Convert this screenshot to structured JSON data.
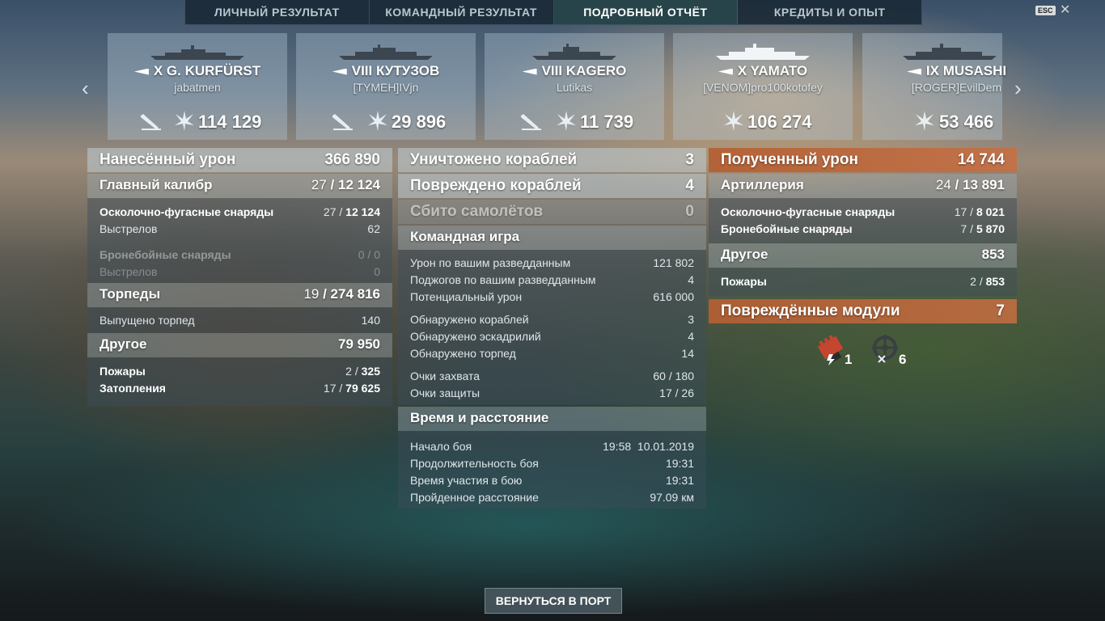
{
  "tabs": [
    "ЛИЧНЫЙ РЕЗУЛЬТАТ",
    "КОМАНДНЫЙ РЕЗУЛЬТАТ",
    "ПОДРОБНЫЙ ОТЧЁТ",
    "КРЕДИТЫ И ОПЫТ"
  ],
  "active_tab": "ПОДРОБНЫЙ ОТЧЁТ",
  "esc_label": "ESC",
  "close_glyph": "✕",
  "nav": {
    "prev": "‹",
    "next": "›"
  },
  "cards": [
    {
      "ship": "X G. KURFÜRST",
      "player": "jabatmen",
      "value": "114 129",
      "torpedo_icon": true
    },
    {
      "ship": "VIII КУТУЗОВ",
      "player": "[TYMEH]IVjn",
      "value": "29 896",
      "torpedo_icon": true
    },
    {
      "ship": "VIII KAGERO",
      "player": "Lutikas",
      "value": "11 739",
      "torpedo_icon": true
    },
    {
      "ship": "X YAMATO",
      "player": "[VENOM]pro100kotofey",
      "value": "106 274",
      "torpedo_icon": false
    },
    {
      "ship": "IX MUSASHI",
      "player": "[ROGER]EvilDem",
      "value": "53 466",
      "torpedo_icon": false
    }
  ],
  "left": {
    "damage": {
      "label": "Нанесённый урон",
      "value": "366 890"
    },
    "main": {
      "label": "Главный калибр",
      "a": "27",
      "b": "12 124"
    },
    "he": {
      "label": "Осколочно-фугасные снаряды",
      "a": "27",
      "b": "12 124"
    },
    "he_shots": {
      "label": "Выстрелов",
      "value": "62"
    },
    "ap": {
      "label": "Бронебойные снаряды",
      "value": "0 / 0"
    },
    "ap_shots": {
      "label": "Выстрелов",
      "value": "0"
    },
    "torp": {
      "label": "Торпеды",
      "a": "19",
      "b": "274 816"
    },
    "torp_launched": {
      "label": "Выпущено торпед",
      "value": "140"
    },
    "other": {
      "label": "Другое",
      "value": "79 950"
    },
    "fires": {
      "label": "Пожары",
      "a": "2",
      "b": "325"
    },
    "floods": {
      "label": "Затопления",
      "a": "17",
      "b": "79 625"
    }
  },
  "middle": {
    "destroyed": {
      "label": "Уничтожено кораблей",
      "value": "3"
    },
    "damaged": {
      "label": "Повреждено кораблей",
      "value": "4"
    },
    "planes": {
      "label": "Сбито самолётов",
      "value": "0"
    },
    "team": {
      "label": "Командная игра"
    },
    "team_rows": [
      {
        "label": "Урон по вашим разведданным",
        "value": "121 802"
      },
      {
        "label": "Поджогов по вашим разведданным",
        "value": "4"
      },
      {
        "label": "Потенциальный урон",
        "value": "616 000"
      }
    ],
    "spot_rows": [
      {
        "label": "Обнаружено кораблей",
        "value": "3"
      },
      {
        "label": "Обнаружено эскадрилий",
        "value": "4"
      },
      {
        "label": "Обнаружено торпед",
        "value": "14"
      }
    ],
    "cap_rows": [
      {
        "label": "Очки захвата",
        "value": "60 / 180"
      },
      {
        "label": "Очки защиты",
        "value": "17 / 26"
      }
    ],
    "time": {
      "label": "Время и расстояние"
    },
    "time_rows": [
      {
        "label": "Начало боя",
        "value": "19:58  10.01.2019"
      },
      {
        "label": "Продолжительность боя",
        "value": "19:31"
      },
      {
        "label": "Время участия в бою",
        "value": "19:31"
      },
      {
        "label": "Пройденное расстояние",
        "value": "97.09 км"
      }
    ]
  },
  "right": {
    "received": {
      "label": "Полученный урон",
      "value": "14 744"
    },
    "artillery": {
      "label": "Артиллерия",
      "a": "24",
      "b": "13 891"
    },
    "he": {
      "label": "Осколочно-фугасные снаряды",
      "a": "17",
      "b": "8 021"
    },
    "ap": {
      "label": "Бронебойные снаряды",
      "a": "7",
      "b": "5 870"
    },
    "other": {
      "label": "Другое",
      "value": "853"
    },
    "fires": {
      "label": "Пожары",
      "a": "2",
      "b": "853"
    },
    "modules": {
      "label": "Повреждённые модули",
      "value": "7"
    },
    "module_counts": {
      "engine": "1",
      "steering": "6"
    }
  },
  "return_button": "ВЕРНУТЬСЯ В ПОРТ",
  "colors": {
    "accent_orange": "#c0683c",
    "header_bg": "#bfcdd7"
  }
}
